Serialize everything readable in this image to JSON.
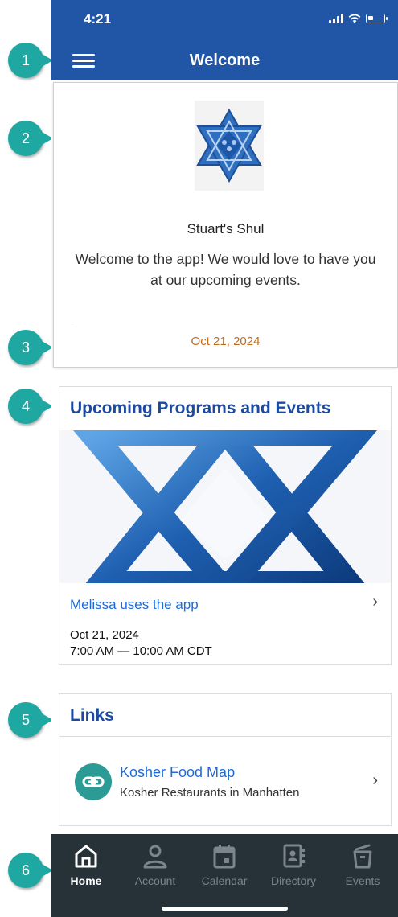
{
  "status_bar": {
    "time": "4:21"
  },
  "header": {
    "title": "Welcome"
  },
  "welcome_card": {
    "org_name": "Stuart's Shul",
    "message": "Welcome to the app! We would love to have you at our upcoming events.",
    "date": "Oct 21, 2024"
  },
  "events": {
    "section_title": "Upcoming Programs and Events",
    "items": [
      {
        "title": "Melissa uses the app",
        "date": "Oct 21, 2024",
        "time": "7:00 AM — 10:00 AM CDT"
      }
    ]
  },
  "links": {
    "section_title": "Links",
    "items": [
      {
        "title": "Kosher Food Map",
        "subtitle": "Kosher Restaurants in Manhatten"
      }
    ]
  },
  "tabbar": {
    "tabs": [
      {
        "label": "Home",
        "active": true
      },
      {
        "label": "Account",
        "active": false
      },
      {
        "label": "Calendar",
        "active": false
      },
      {
        "label": "Directory",
        "active": false
      },
      {
        "label": "Events",
        "active": false
      }
    ]
  },
  "callouts": [
    "1",
    "2",
    "3",
    "4",
    "5",
    "6"
  ],
  "colors": {
    "header_blue": "#2155a5",
    "title_blue": "#1b4aa0",
    "link_blue": "#1d6ad8",
    "date_orange": "#c06d1c",
    "tabbar_dark": "#263238",
    "callout_teal": "#1fa7a2",
    "link_icon_teal": "#2d9b95"
  }
}
